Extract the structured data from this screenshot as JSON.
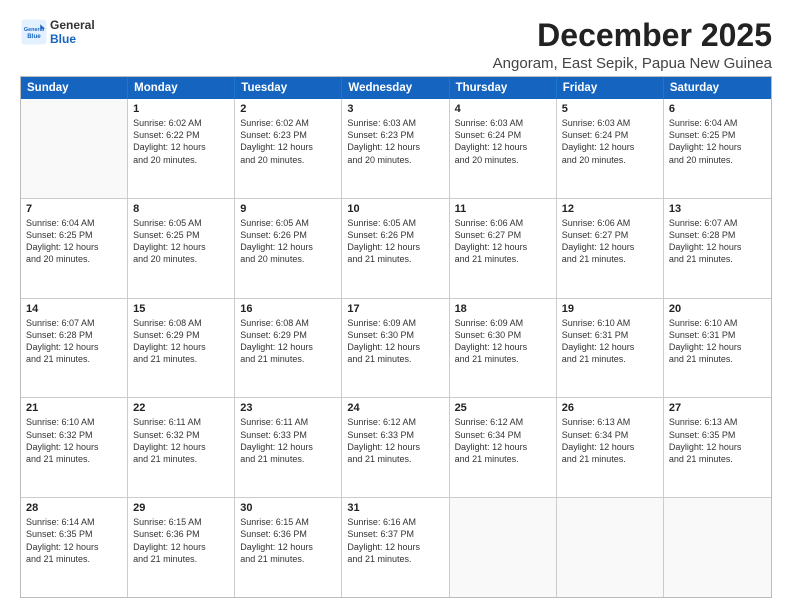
{
  "logo": {
    "line1": "General",
    "line2": "Blue"
  },
  "title": "December 2025",
  "subtitle": "Angoram, East Sepik, Papua New Guinea",
  "header": {
    "days": [
      "Sunday",
      "Monday",
      "Tuesday",
      "Wednesday",
      "Thursday",
      "Friday",
      "Saturday"
    ]
  },
  "weeks": [
    [
      {
        "day": "",
        "empty": true
      },
      {
        "day": "1",
        "sunrise": "6:02 AM",
        "sunset": "6:22 PM",
        "daylight": "12 hours and 20 minutes."
      },
      {
        "day": "2",
        "sunrise": "6:02 AM",
        "sunset": "6:23 PM",
        "daylight": "12 hours and 20 minutes."
      },
      {
        "day": "3",
        "sunrise": "6:03 AM",
        "sunset": "6:23 PM",
        "daylight": "12 hours and 20 minutes."
      },
      {
        "day": "4",
        "sunrise": "6:03 AM",
        "sunset": "6:24 PM",
        "daylight": "12 hours and 20 minutes."
      },
      {
        "day": "5",
        "sunrise": "6:03 AM",
        "sunset": "6:24 PM",
        "daylight": "12 hours and 20 minutes."
      },
      {
        "day": "6",
        "sunrise": "6:04 AM",
        "sunset": "6:25 PM",
        "daylight": "12 hours and 20 minutes."
      }
    ],
    [
      {
        "day": "7",
        "sunrise": "6:04 AM",
        "sunset": "6:25 PM",
        "daylight": "12 hours and 20 minutes."
      },
      {
        "day": "8",
        "sunrise": "6:05 AM",
        "sunset": "6:25 PM",
        "daylight": "12 hours and 20 minutes."
      },
      {
        "day": "9",
        "sunrise": "6:05 AM",
        "sunset": "6:26 PM",
        "daylight": "12 hours and 20 minutes."
      },
      {
        "day": "10",
        "sunrise": "6:05 AM",
        "sunset": "6:26 PM",
        "daylight": "12 hours and 21 minutes."
      },
      {
        "day": "11",
        "sunrise": "6:06 AM",
        "sunset": "6:27 PM",
        "daylight": "12 hours and 21 minutes."
      },
      {
        "day": "12",
        "sunrise": "6:06 AM",
        "sunset": "6:27 PM",
        "daylight": "12 hours and 21 minutes."
      },
      {
        "day": "13",
        "sunrise": "6:07 AM",
        "sunset": "6:28 PM",
        "daylight": "12 hours and 21 minutes."
      }
    ],
    [
      {
        "day": "14",
        "sunrise": "6:07 AM",
        "sunset": "6:28 PM",
        "daylight": "12 hours and 21 minutes."
      },
      {
        "day": "15",
        "sunrise": "6:08 AM",
        "sunset": "6:29 PM",
        "daylight": "12 hours and 21 minutes."
      },
      {
        "day": "16",
        "sunrise": "6:08 AM",
        "sunset": "6:29 PM",
        "daylight": "12 hours and 21 minutes."
      },
      {
        "day": "17",
        "sunrise": "6:09 AM",
        "sunset": "6:30 PM",
        "daylight": "12 hours and 21 minutes."
      },
      {
        "day": "18",
        "sunrise": "6:09 AM",
        "sunset": "6:30 PM",
        "daylight": "12 hours and 21 minutes."
      },
      {
        "day": "19",
        "sunrise": "6:10 AM",
        "sunset": "6:31 PM",
        "daylight": "12 hours and 21 minutes."
      },
      {
        "day": "20",
        "sunrise": "6:10 AM",
        "sunset": "6:31 PM",
        "daylight": "12 hours and 21 minutes."
      }
    ],
    [
      {
        "day": "21",
        "sunrise": "6:10 AM",
        "sunset": "6:32 PM",
        "daylight": "12 hours and 21 minutes."
      },
      {
        "day": "22",
        "sunrise": "6:11 AM",
        "sunset": "6:32 PM",
        "daylight": "12 hours and 21 minutes."
      },
      {
        "day": "23",
        "sunrise": "6:11 AM",
        "sunset": "6:33 PM",
        "daylight": "12 hours and 21 minutes."
      },
      {
        "day": "24",
        "sunrise": "6:12 AM",
        "sunset": "6:33 PM",
        "daylight": "12 hours and 21 minutes."
      },
      {
        "day": "25",
        "sunrise": "6:12 AM",
        "sunset": "6:34 PM",
        "daylight": "12 hours and 21 minutes."
      },
      {
        "day": "26",
        "sunrise": "6:13 AM",
        "sunset": "6:34 PM",
        "daylight": "12 hours and 21 minutes."
      },
      {
        "day": "27",
        "sunrise": "6:13 AM",
        "sunset": "6:35 PM",
        "daylight": "12 hours and 21 minutes."
      }
    ],
    [
      {
        "day": "28",
        "sunrise": "6:14 AM",
        "sunset": "6:35 PM",
        "daylight": "12 hours and 21 minutes."
      },
      {
        "day": "29",
        "sunrise": "6:15 AM",
        "sunset": "6:36 PM",
        "daylight": "12 hours and 21 minutes."
      },
      {
        "day": "30",
        "sunrise": "6:15 AM",
        "sunset": "6:36 PM",
        "daylight": "12 hours and 21 minutes."
      },
      {
        "day": "31",
        "sunrise": "6:16 AM",
        "sunset": "6:37 PM",
        "daylight": "12 hours and 21 minutes."
      },
      {
        "day": "",
        "empty": true
      },
      {
        "day": "",
        "empty": true
      },
      {
        "day": "",
        "empty": true
      }
    ]
  ],
  "labels": {
    "sunrise_prefix": "Sunrise: ",
    "sunset_prefix": "Sunset: ",
    "daylight_prefix": "Daylight: "
  }
}
